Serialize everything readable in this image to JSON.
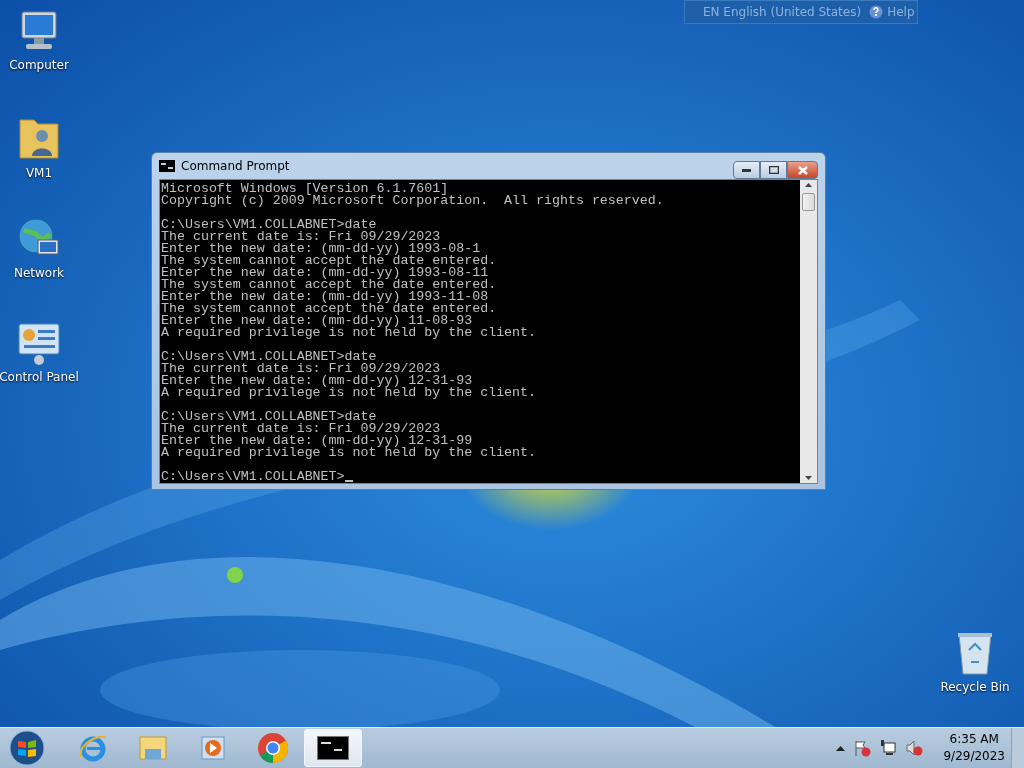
{
  "language_bar": {
    "language": "EN English (United States)",
    "help": "Help"
  },
  "desktop_icons": [
    {
      "kind": "computer",
      "label": "Computer"
    },
    {
      "kind": "user-folder",
      "label": "VM1"
    },
    {
      "kind": "network",
      "label": "Network"
    },
    {
      "kind": "control-panel",
      "label": "Control Panel"
    }
  ],
  "recycle_bin": {
    "label": "Recycle Bin"
  },
  "window": {
    "title": "Command Prompt",
    "console_blocks": [
      [
        "Microsoft Windows [Version 6.1.7601]",
        "Copyright (c) 2009 Microsoft Corporation.  All rights reserved."
      ],
      [
        "C:\\Users\\VM1.COLLABNET>date",
        "The current date is: Fri 09/29/2023",
        "Enter the new date: (mm-dd-yy) 1993-08-1",
        "The system cannot accept the date entered.",
        "Enter the new date: (mm-dd-yy) 1993-08-11",
        "The system cannot accept the date entered.",
        "Enter the new date: (mm-dd-yy) 1993-11-08",
        "The system cannot accept the date entered.",
        "Enter the new date: (mm-dd-yy) 11-08-93",
        "A required privilege is not held by the client."
      ],
      [
        "C:\\Users\\VM1.COLLABNET>date",
        "The current date is: Fri 09/29/2023",
        "Enter the new date: (mm-dd-yy) 12-31-93",
        "A required privilege is not held by the client."
      ],
      [
        "C:\\Users\\VM1.COLLABNET>date",
        "The current date is: Fri 09/29/2023",
        "Enter the new date: (mm-dd-yy) 12-31-99",
        "A required privilege is not held by the client."
      ]
    ],
    "prompt": "C:\\Users\\VM1.COLLABNET>"
  },
  "taskbar": {
    "apps": [
      {
        "kind": "ie",
        "selected": false
      },
      {
        "kind": "explorer",
        "selected": false
      },
      {
        "kind": "media",
        "selected": false
      },
      {
        "kind": "chrome",
        "selected": false
      },
      {
        "kind": "cmd",
        "selected": true
      }
    ],
    "clock": {
      "time": "6:35 AM",
      "date": "9/29/2023"
    }
  }
}
